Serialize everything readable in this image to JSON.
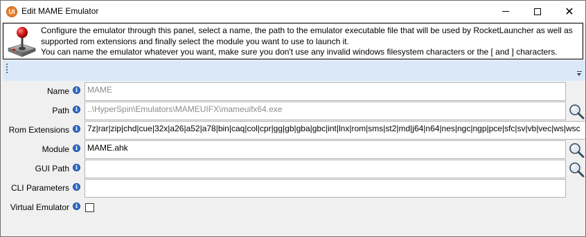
{
  "window": {
    "title": "Edit MAME Emulator",
    "app_icon_glyph": "UI"
  },
  "banner": {
    "icon": "joystick-icon",
    "lines": [
      "Configure the emulator through this panel, select a name, the path to the emulator executable file that will be used by RocketLauncher as well as",
      "supported rom extensions and finally select the module you want to use to launch it.",
      "You can name the emulator whatever you want, make sure you don't use any invalid windows filesystem characters or the [ and ] characters."
    ]
  },
  "form": {
    "name": {
      "label": "Name",
      "value": "MAME"
    },
    "path": {
      "label": "Path",
      "value": "..\\HyperSpin\\Emulators\\MAMEUIFX\\mameuifx64.exe"
    },
    "rom_extensions": {
      "label": "Rom Extensions",
      "value": "7z|rar|zip|chd|cue|32x|a26|a52|a78|bin|caq|col|cpr|gg|gb|gba|gbc|int|lnx|rom|sms|st2|md|j64|n64|nes|ngc|ngp|pce|sfc|sv|vb|vec|ws|wsc"
    },
    "module": {
      "label": "Module",
      "value": "MAME.ahk"
    },
    "gui_path": {
      "label": "GUI Path",
      "value": ""
    },
    "cli_parameters": {
      "label": "CLI Parameters",
      "value": ""
    },
    "virtual_emulator": {
      "label": "Virtual Emulator",
      "checked": false
    }
  },
  "colors": {
    "toolbar_bg": "#dbe8f7",
    "info_icon": "#2f6dcc",
    "app_icon": "#e97e2a"
  }
}
